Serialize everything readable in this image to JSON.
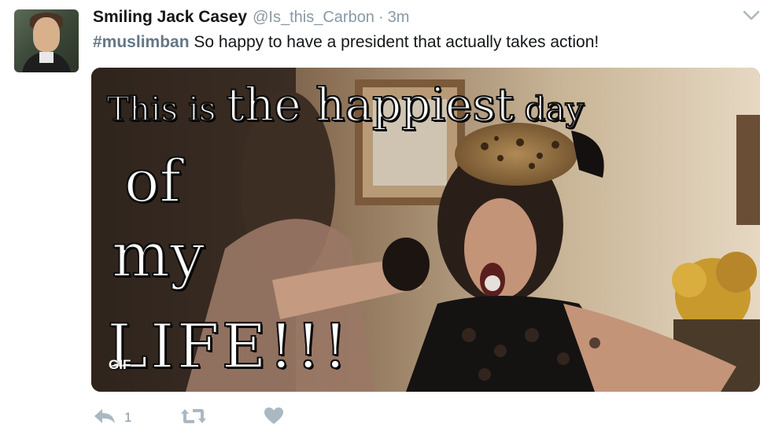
{
  "tweet": {
    "display_name": "Smiling Jack Casey",
    "handle": "@Is_this_Carbon",
    "separator": "·",
    "time": "3m",
    "hashtag": "#muslimban",
    "text": " So happy to have a president that actually takes action!",
    "media": {
      "caption_line1_a": "This is ",
      "caption_line1_b": "the happiest",
      "caption_line1_c": " day",
      "caption_line2": "of",
      "caption_line3": "my",
      "caption_line4": "LIFE!!!",
      "badge": "GIF"
    },
    "actions": {
      "reply_count": "1",
      "retweet_count": "",
      "like_count": ""
    }
  },
  "icons": {
    "caret": "chevron-down-icon",
    "reply": "reply-icon",
    "retweet": "retweet-icon",
    "like": "heart-icon"
  },
  "colors": {
    "name": "#14171a",
    "meta": "#8899a6",
    "hashtag": "#657786",
    "icon": "#aab8c2"
  }
}
